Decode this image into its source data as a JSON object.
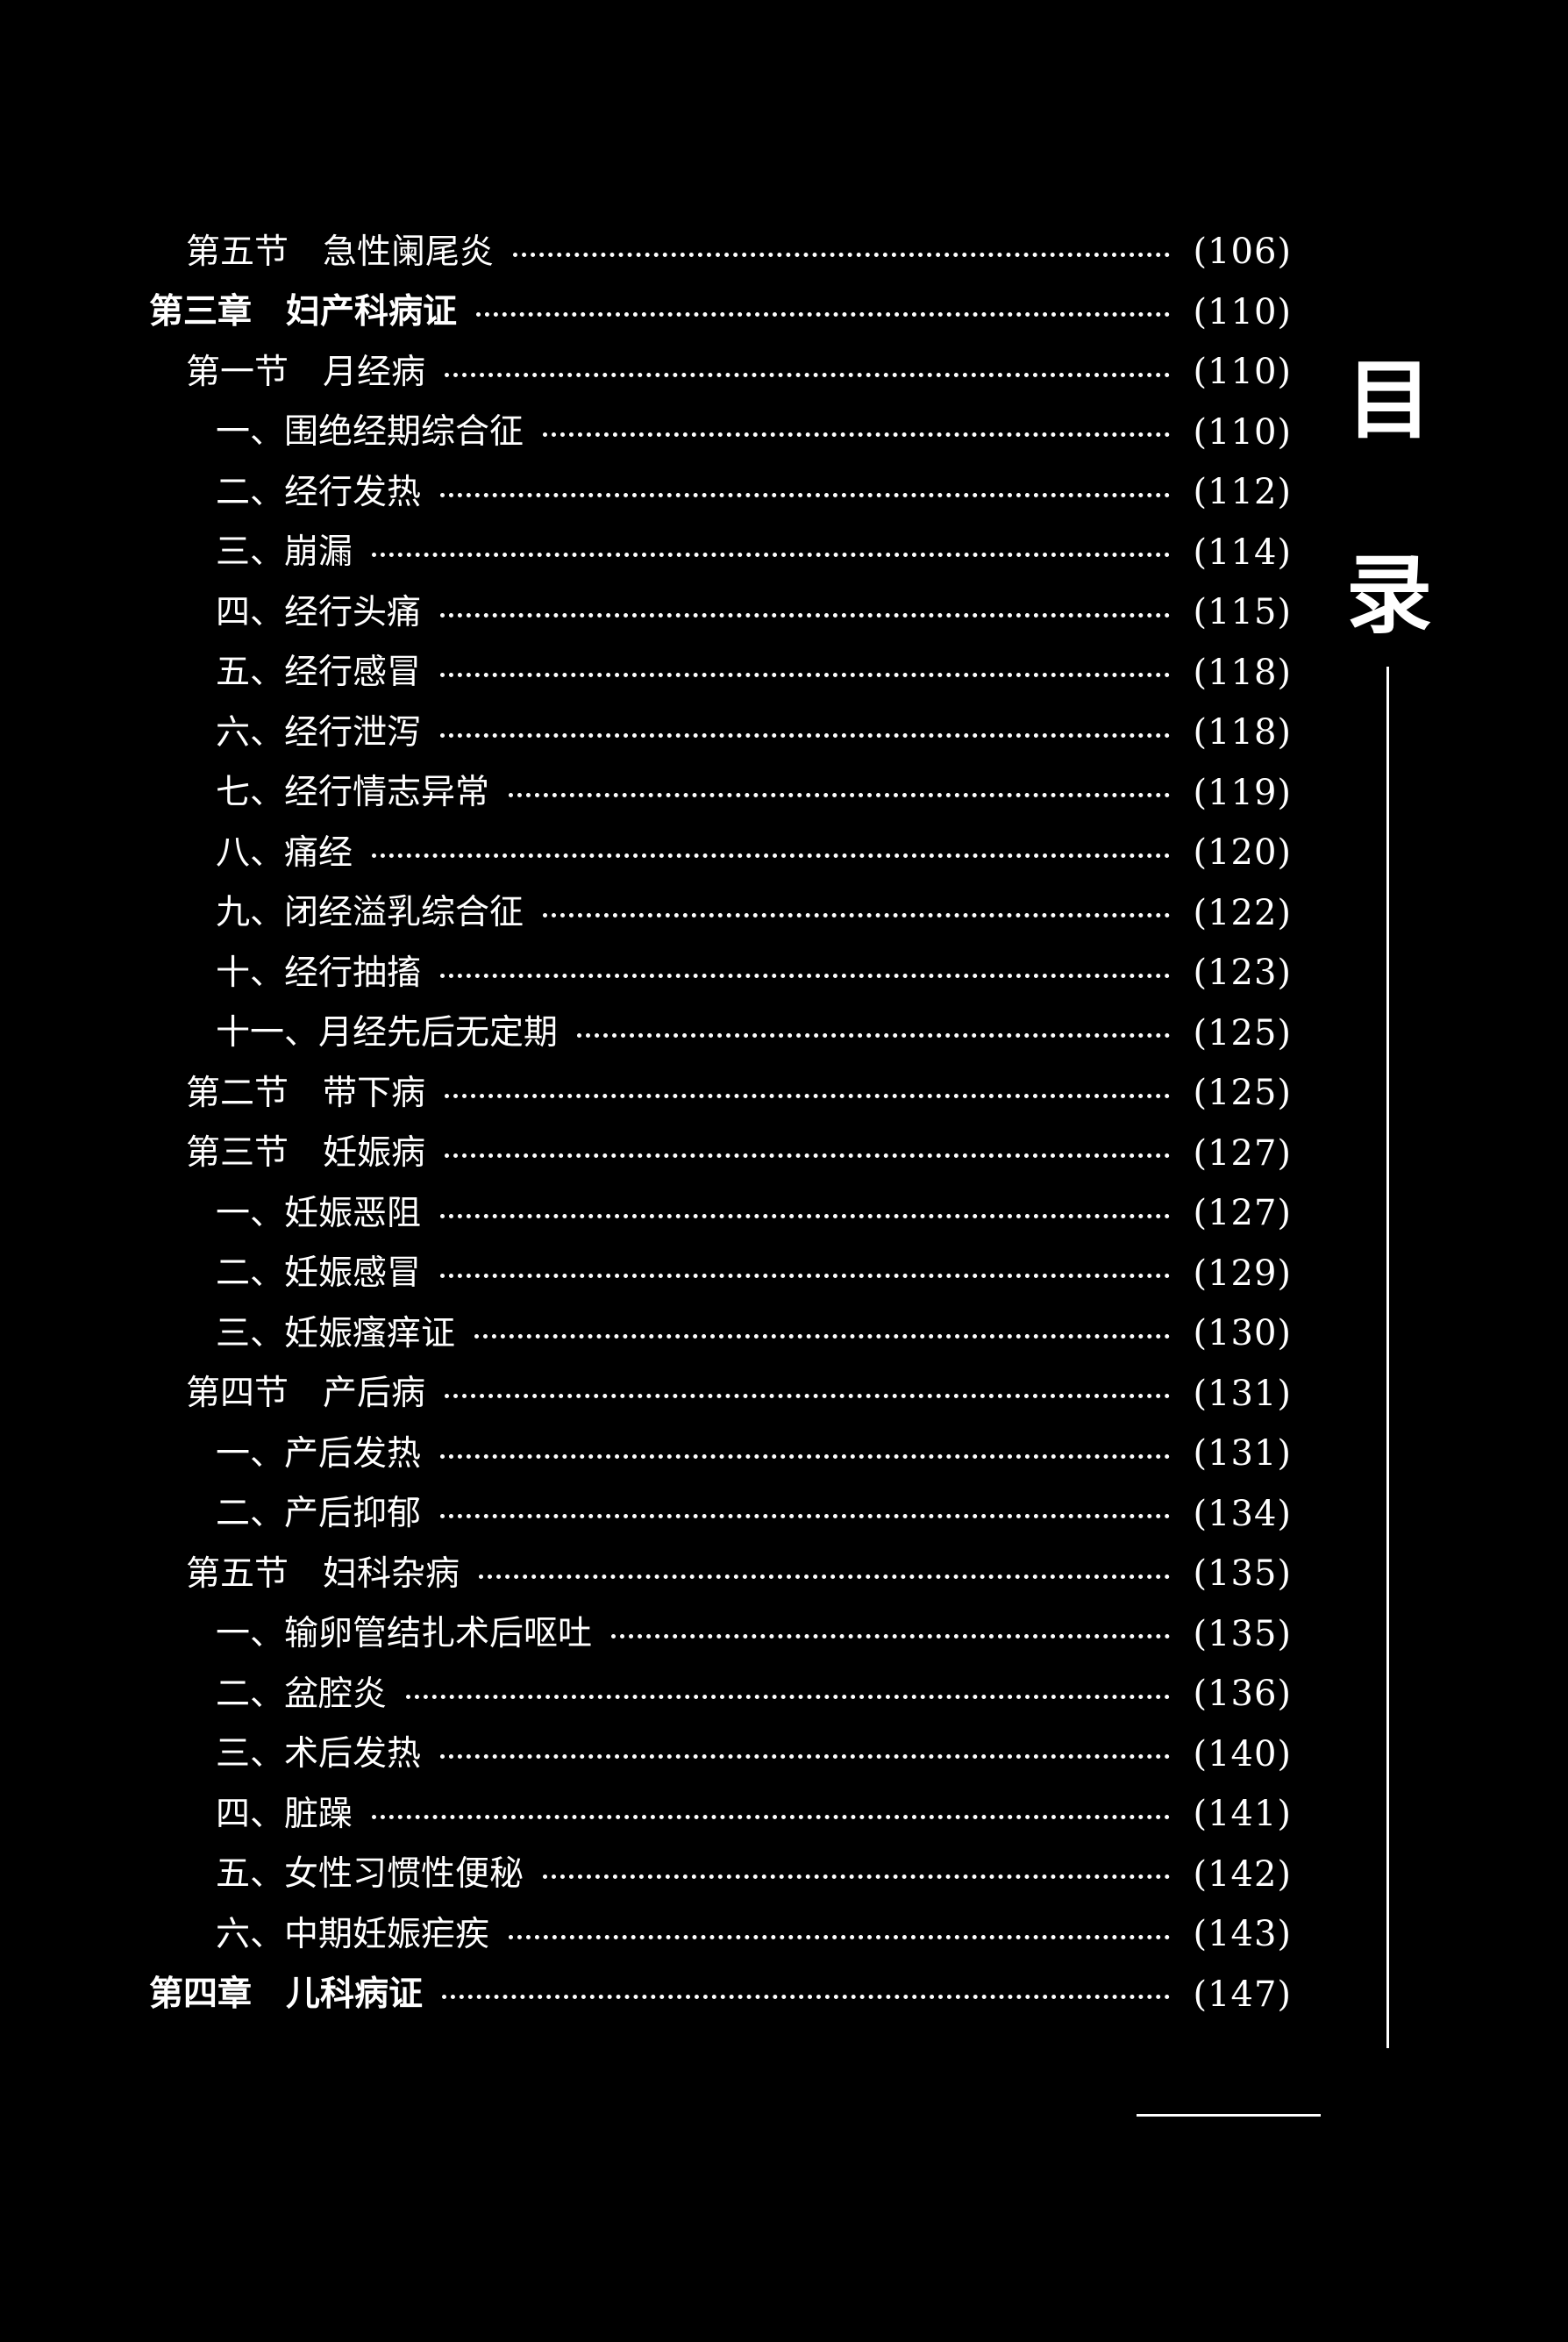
{
  "side_title": [
    "目",
    "录"
  ],
  "entries": [
    {
      "level": "section",
      "title": "第五节　急性阑尾炎",
      "page": "(106)"
    },
    {
      "level": "chapter",
      "title": "第三章　妇产科病证",
      "page": "(110)"
    },
    {
      "level": "section",
      "title": "第一节　月经病",
      "page": "(110)"
    },
    {
      "level": "item",
      "title": "一、围绝经期综合征",
      "page": "(110)"
    },
    {
      "level": "item",
      "title": "二、经行发热",
      "page": "(112)"
    },
    {
      "level": "item",
      "title": "三、崩漏",
      "page": "(114)"
    },
    {
      "level": "item",
      "title": "四、经行头痛",
      "page": "(115)"
    },
    {
      "level": "item",
      "title": "五、经行感冒",
      "page": "(118)"
    },
    {
      "level": "item",
      "title": "六、经行泄泻",
      "page": "(118)"
    },
    {
      "level": "item",
      "title": "七、经行情志异常",
      "page": "(119)"
    },
    {
      "level": "item",
      "title": "八、痛经",
      "page": "(120)"
    },
    {
      "level": "item",
      "title": "九、闭经溢乳综合征",
      "page": "(122)"
    },
    {
      "level": "item",
      "title": "十、经行抽搐",
      "page": "(123)"
    },
    {
      "level": "item",
      "title": "十一、月经先后无定期",
      "page": "(125)"
    },
    {
      "level": "section",
      "title": "第二节　带下病",
      "page": "(125)"
    },
    {
      "level": "section",
      "title": "第三节　妊娠病",
      "page": "(127)"
    },
    {
      "level": "item",
      "title": "一、妊娠恶阻",
      "page": "(127)"
    },
    {
      "level": "item",
      "title": "二、妊娠感冒",
      "page": "(129)"
    },
    {
      "level": "item",
      "title": "三、妊娠瘙痒证",
      "page": "(130)"
    },
    {
      "level": "section",
      "title": "第四节　产后病",
      "page": "(131)"
    },
    {
      "level": "item",
      "title": "一、产后发热",
      "page": "(131)"
    },
    {
      "level": "item",
      "title": "二、产后抑郁",
      "page": "(134)"
    },
    {
      "level": "section",
      "title": "第五节　妇科杂病",
      "page": "(135)"
    },
    {
      "level": "item",
      "title": "一、输卵管结扎术后呕吐",
      "page": "(135)"
    },
    {
      "level": "item",
      "title": "二、盆腔炎",
      "page": "(136)"
    },
    {
      "level": "item",
      "title": "三、术后发热",
      "page": "(140)"
    },
    {
      "level": "item",
      "title": "四、脏躁",
      "page": "(141)"
    },
    {
      "level": "item",
      "title": "五、女性习惯性便秘",
      "page": "(142)"
    },
    {
      "level": "item",
      "title": "六、中期妊娠疟疾",
      "page": "(143)"
    },
    {
      "level": "chapter",
      "title": "第四章　儿科病证",
      "page": "(147)"
    }
  ]
}
